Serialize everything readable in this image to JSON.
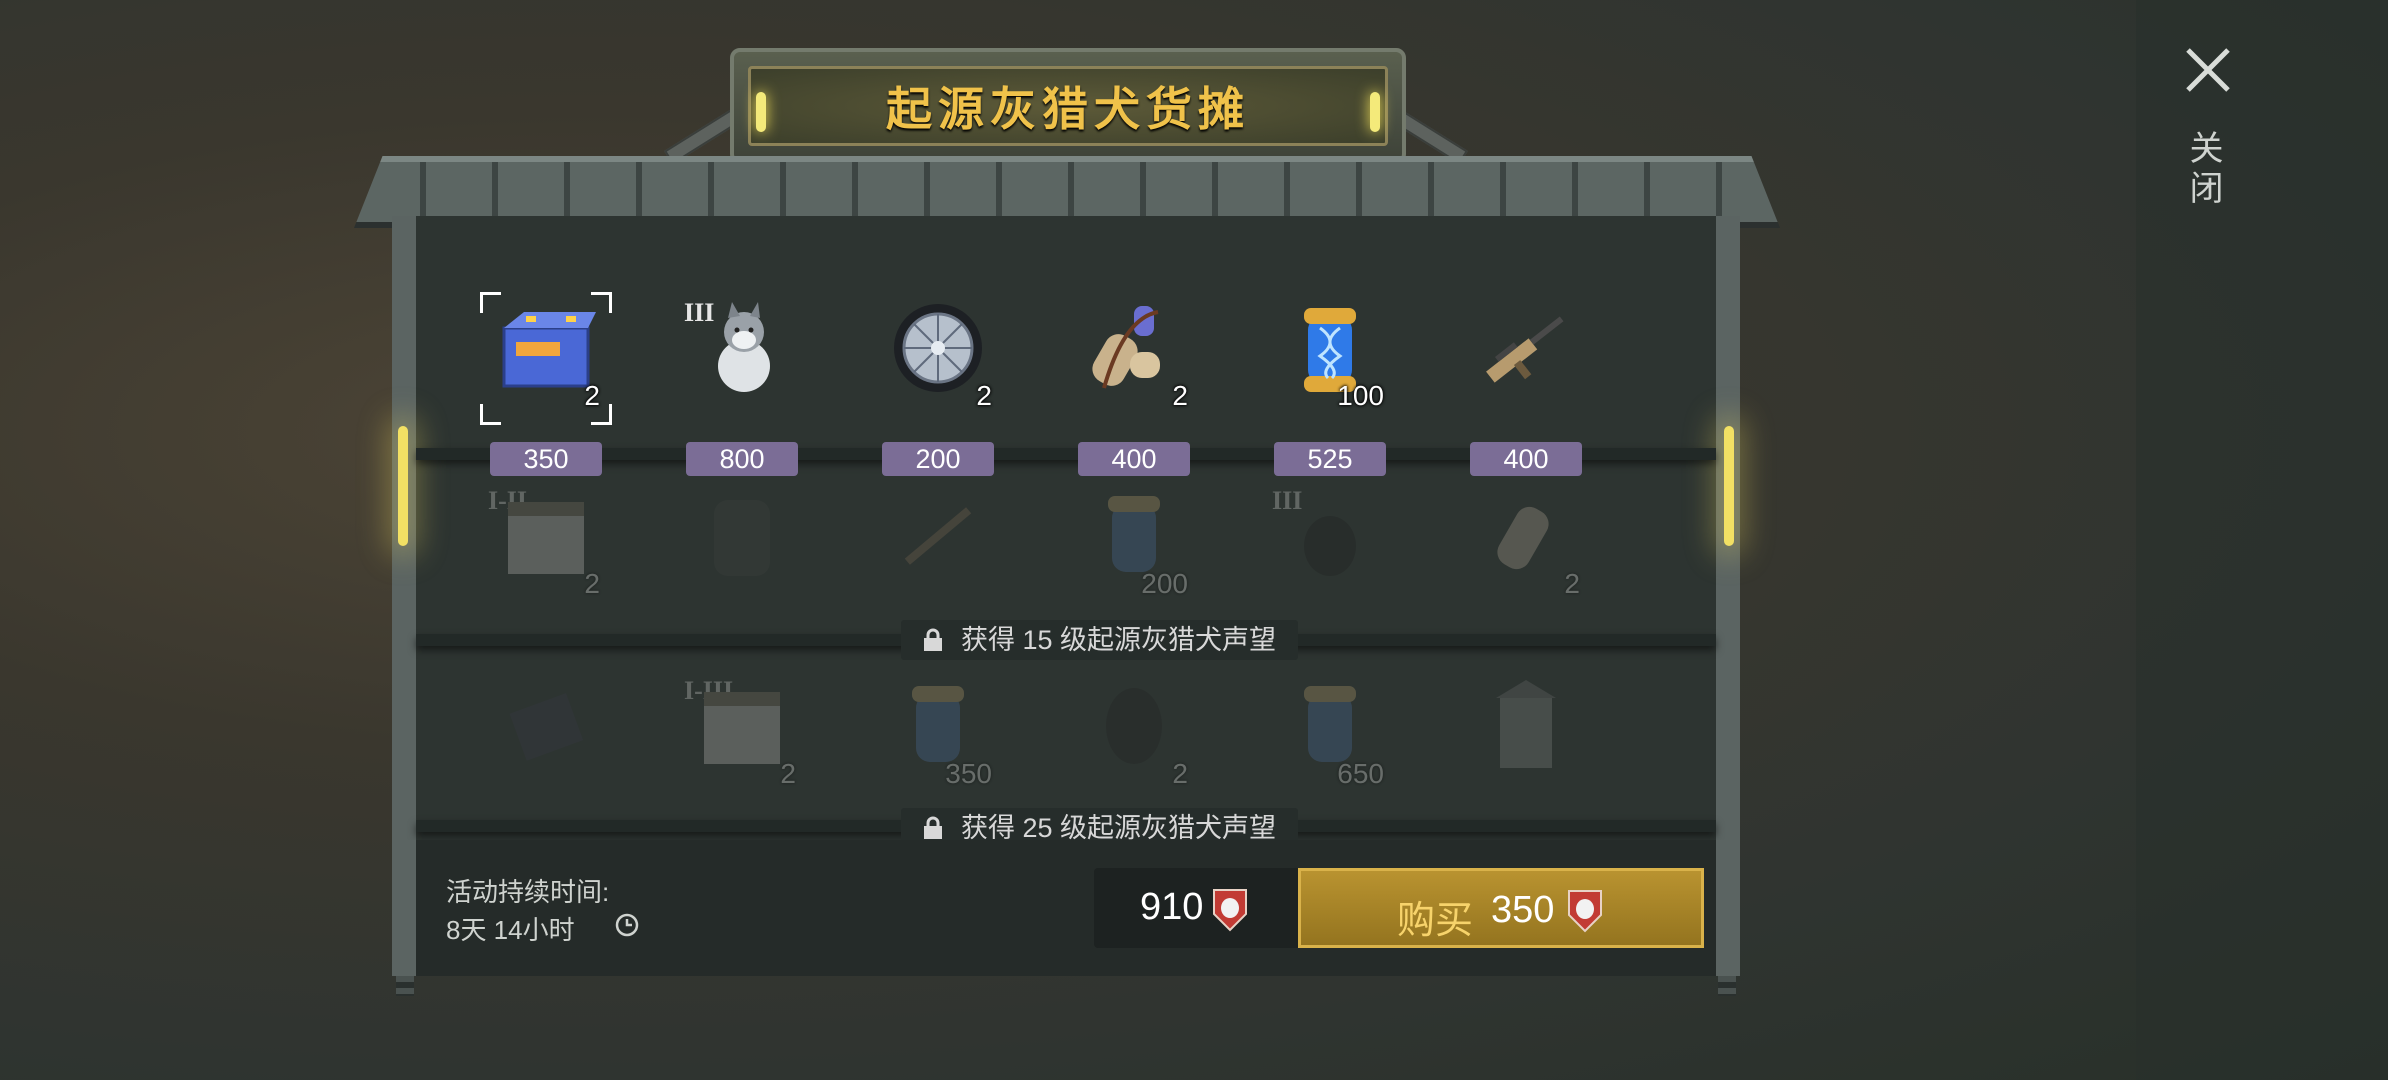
{
  "shop": {
    "title": "起源灰猎犬货摊",
    "close_label": "关闭",
    "rows": [
      {
        "locked": false,
        "items": [
          {
            "icon": "battery-icon",
            "qty": "2",
            "tier": "",
            "price": "350",
            "selected": true
          },
          {
            "icon": "husky-dog-icon",
            "qty": "",
            "tier": "III",
            "price": "800"
          },
          {
            "icon": "wheel-icon",
            "qty": "2",
            "tier": "",
            "price": "200"
          },
          {
            "icon": "bedroll-sling-icon",
            "qty": "2",
            "tier": "",
            "price": "400"
          },
          {
            "icon": "dna-capsule-icon",
            "qty": "100",
            "tier": "",
            "price": "525"
          },
          {
            "icon": "assault-rifle-icon",
            "qty": "",
            "tier": "",
            "price": "400"
          }
        ]
      },
      {
        "locked": true,
        "lock_text": "获得 15 级起源灰猎犬声望",
        "items": [
          {
            "icon": "crate-icon",
            "qty": "2",
            "tier": "I-II"
          },
          {
            "icon": "backpack-icon",
            "qty": "",
            "tier": ""
          },
          {
            "icon": "rifle-icon",
            "qty": "",
            "tier": ""
          },
          {
            "icon": "dna-capsule-icon",
            "qty": "200",
            "tier": ""
          },
          {
            "icon": "dog-icon",
            "qty": "",
            "tier": "III"
          },
          {
            "icon": "bedroll-sling-icon",
            "qty": "2",
            "tier": ""
          }
        ]
      },
      {
        "locked": true,
        "lock_text": "获得 25 级起源灰猎犬声望",
        "items": [
          {
            "icon": "badge-card-icon",
            "qty": "",
            "tier": ""
          },
          {
            "icon": "crate-icon",
            "qty": "2",
            "tier": "I-III"
          },
          {
            "icon": "dna-capsule-icon",
            "qty": "350",
            "tier": ""
          },
          {
            "icon": "gas-mask-icon",
            "qty": "2",
            "tier": ""
          },
          {
            "icon": "dna-capsule-icon",
            "qty": "650",
            "tier": ""
          },
          {
            "icon": "shrine-icon",
            "qty": "",
            "tier": ""
          }
        ]
      }
    ]
  },
  "footer": {
    "duration_label": "活动持续时间:",
    "duration_value": "8天 14小时",
    "currency_amount": "910",
    "currency_icon": "wolf-badge-icon",
    "buy_label": "购买",
    "buy_price": "350"
  },
  "colors": {
    "accent": "#f0c24a",
    "price_bg": "#7b6d96",
    "buy_bg": "#b99330"
  }
}
